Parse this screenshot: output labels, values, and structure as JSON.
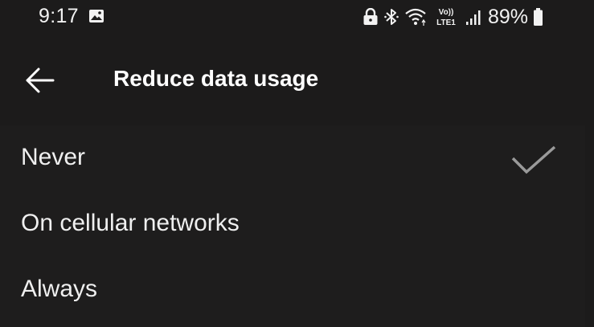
{
  "status_bar": {
    "time": "9:17",
    "battery": "89%",
    "network_badge_top": "Vo))",
    "network_badge_bottom": "LTE1",
    "icons": [
      "gallery-icon",
      "lock-icon",
      "bluetooth-icon",
      "wifi-icon",
      "volte-icon",
      "signal-icon",
      "battery-icon"
    ]
  },
  "app_bar": {
    "title": "Reduce data usage",
    "back_icon": "arrow-left-icon"
  },
  "options": [
    {
      "label": "Never",
      "selected": true
    },
    {
      "label": "On cellular networks",
      "selected": false
    },
    {
      "label": "Always",
      "selected": false
    }
  ],
  "colors": {
    "background": "#1c1b1b",
    "text": "#ffffff",
    "check": "#9a9a9a"
  }
}
